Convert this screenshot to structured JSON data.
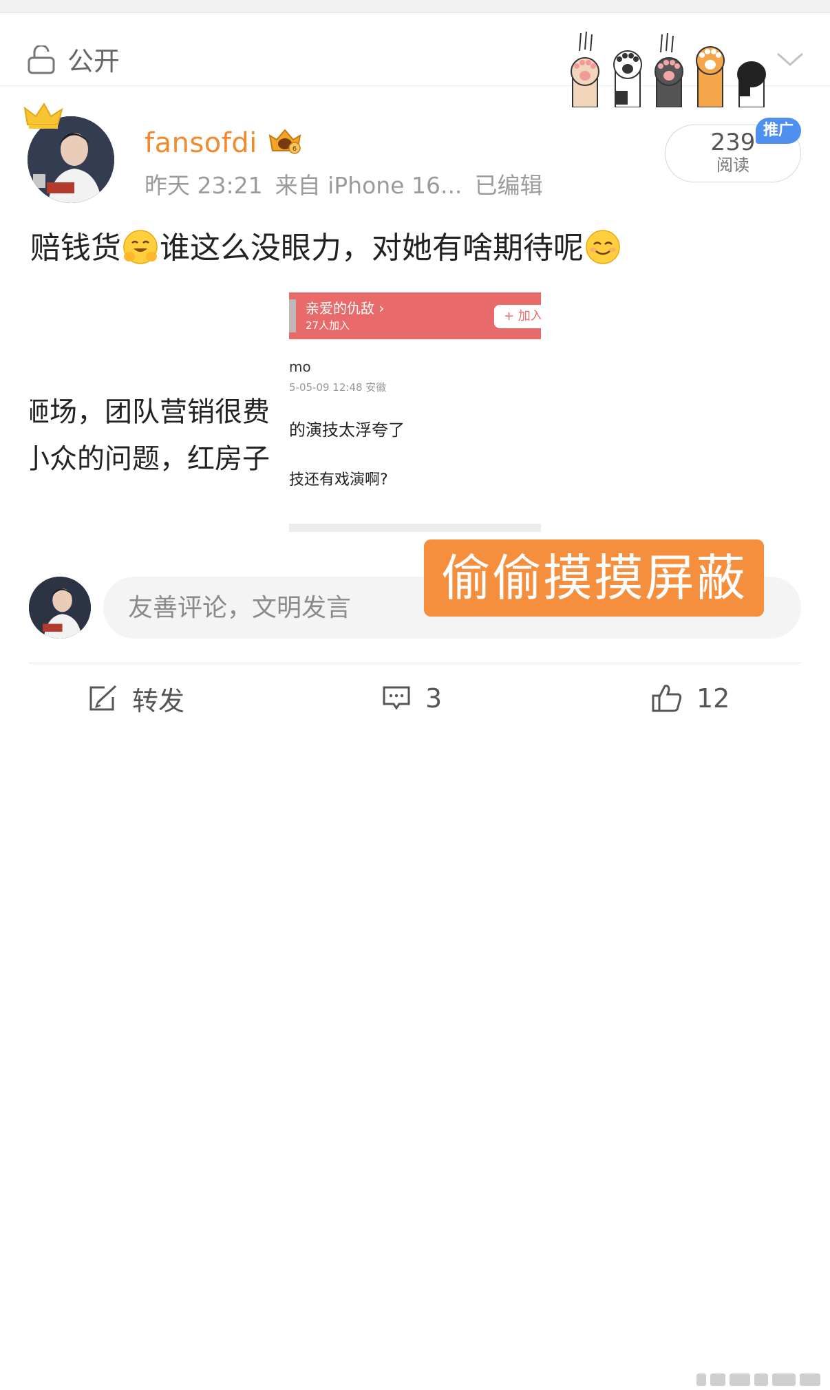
{
  "visibility": {
    "label": "公开"
  },
  "post": {
    "username": "fansofdi",
    "meta": {
      "time": "昨天 23:21",
      "source": "来自 iPhone 16...",
      "edited": "已编辑"
    },
    "reads": {
      "count": "239",
      "label": "阅读"
    },
    "promo_tag": "推广",
    "text": {
      "part1": "赔钱货",
      "part2": "谁这么没眼力，对她有啥期待呢"
    }
  },
  "media": {
    "left_lines": [
      "砸场，团队营销很费",
      "小众的问题，红房子"
    ],
    "screenshot": {
      "group_title": "亲爱的仇敌 ›",
      "group_sub": "27人加入",
      "join_label": "+ 加入",
      "user": "mo",
      "time": "5-05-09 12:48  安徽",
      "line1": "的演技太浮夸了",
      "line2": "技还有戏演啊?"
    }
  },
  "sticker_text": "偷偷摸摸屏蔽",
  "comment": {
    "placeholder": "友善评论，文明发言"
  },
  "actions": {
    "repost": "转发",
    "comments": "3",
    "likes": "12"
  },
  "colors": {
    "username": "#f28a2c",
    "promo": "#4f8ff0",
    "sticker": "#f58f3d",
    "group_header": "#e96a6a"
  },
  "icons": [
    "lock-icon",
    "chevron-down-icon",
    "crown-icon",
    "vip-badge-icon",
    "repost-icon",
    "comment-icon",
    "like-icon"
  ]
}
